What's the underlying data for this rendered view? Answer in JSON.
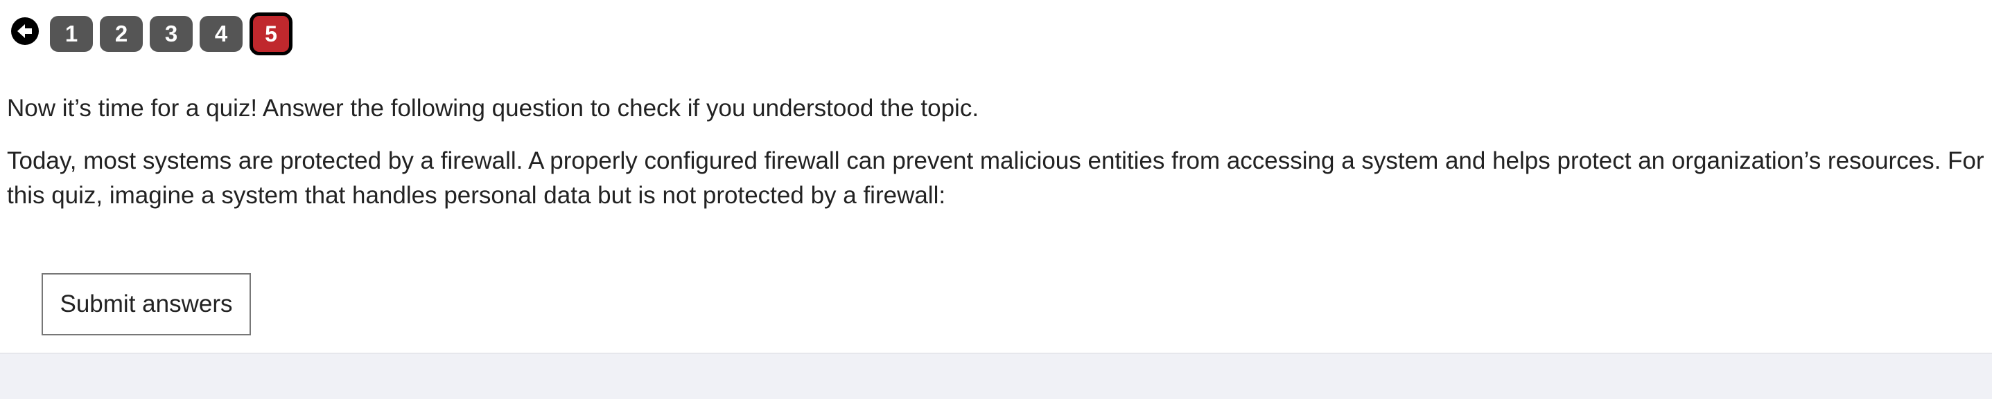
{
  "nav": {
    "back_icon": "arrow-left-circle-icon",
    "steps": [
      "1",
      "2",
      "3",
      "4",
      "5"
    ],
    "active_step": "5",
    "colors": {
      "inactive": "#555555",
      "active": "#c0282d"
    }
  },
  "quiz": {
    "intro": "Now it’s time for a quiz! Answer the following question to check if you understood the topic.",
    "scenario": "Today, most systems are protected by a firewall. A properly configured firewall can prevent malicious entities from accessing a system and helps protect an organization’s resources. For this quiz, imagine a system that handles personal data but is not protected by a firewall:"
  },
  "actions": {
    "submit_label": "Submit answers"
  }
}
